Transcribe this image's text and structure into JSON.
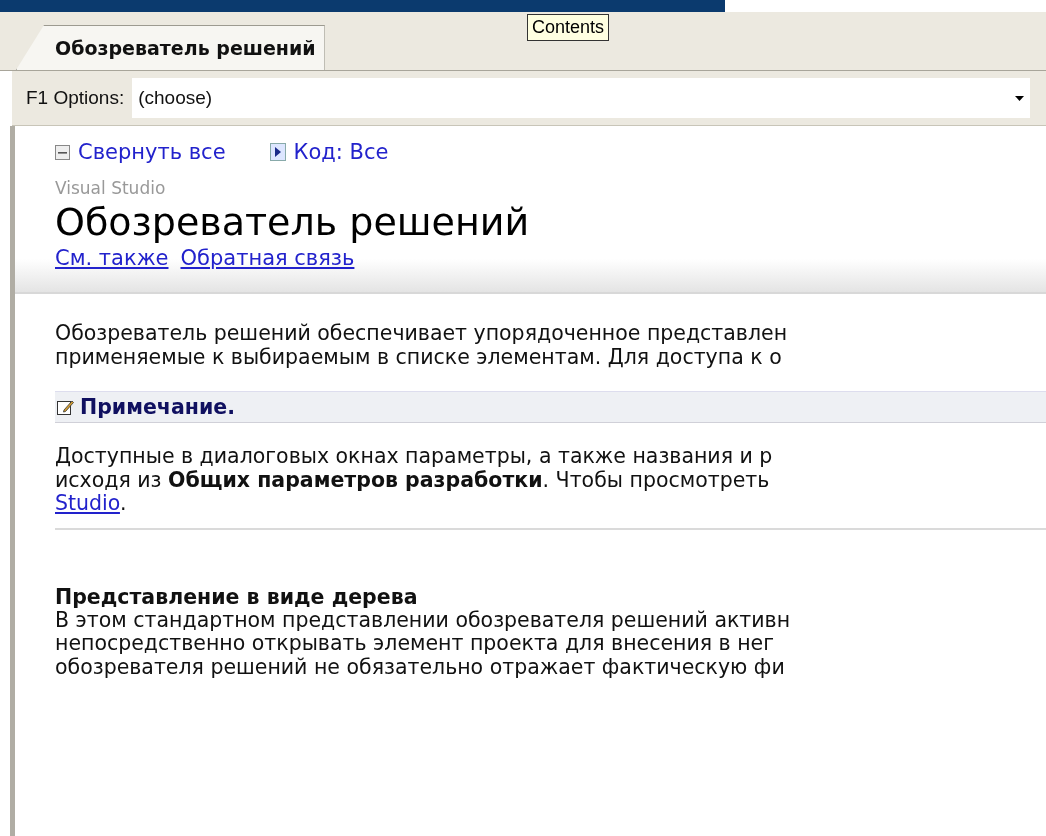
{
  "tabs": [
    {
      "label": "Обозреватель решений",
      "selected": true
    }
  ],
  "tooltip": {
    "text": "Contents"
  },
  "toolbar": {
    "label": "F1 Options:",
    "value": "(choose)"
  },
  "header": {
    "actions": [
      {
        "kind": "collapse",
        "label": "Свернуть все"
      },
      {
        "kind": "filter",
        "label": "Код: Все"
      }
    ],
    "product": "Visual Studio",
    "title": "Обозреватель решений",
    "links": [
      "См. также",
      "Обратная связь"
    ]
  },
  "intro": {
    "lines": [
      "Обозреватель решений обеспечивает упорядоченное представлен",
      "применяемые к выбираемым в списке элементам. Для доступа к о"
    ]
  },
  "note": {
    "title": "Примечание.",
    "lines": [
      "Доступные в диалоговых окнах параметры, а также названия и р",
      "исходя из **Общих параметров разработки**. Чтобы просмотреть"
    ],
    "link": "Studio",
    "link_after": "."
  },
  "section": {
    "heading": "Представление в виде дерева",
    "lines": [
      "В этом стандартном представлении обозревателя решений активн",
      "непосредственно открывать элемент проекта для внесения в нег",
      "обозревателя решений не обязательно отражает фактическую фи"
    ]
  }
}
